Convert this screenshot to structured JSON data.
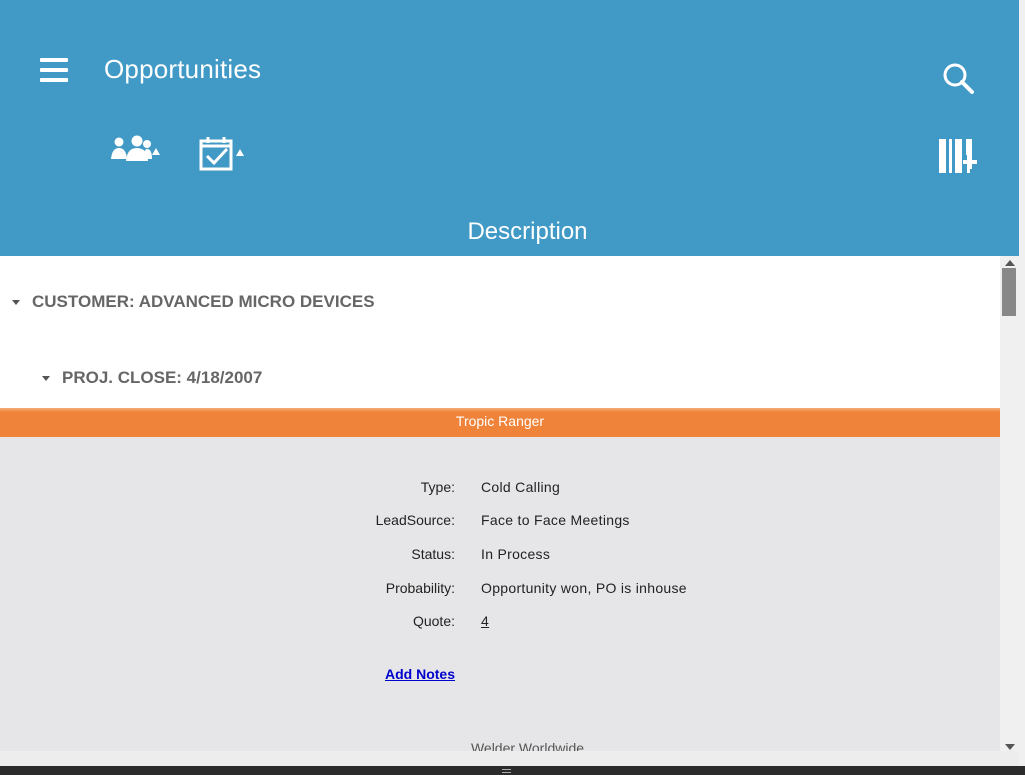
{
  "header": {
    "title": "Opportunities",
    "section_title": "Description",
    "menu_icon": "hamburger-menu-icon",
    "search_icon": "search-icon",
    "group_icon": "group-people-icon",
    "task_icon": "calendar-check-icon",
    "barcode_icon": "barcode-add-icon"
  },
  "groups": {
    "customer": "CUSTOMER: ADVANCED MICRO DEVICES",
    "proj_close": "PROJ. CLOSE: 4/18/2007"
  },
  "record": {
    "title": "Tropic Ranger",
    "fields": [
      {
        "label": "Type:",
        "value": "Cold Calling"
      },
      {
        "label": "LeadSource:",
        "value": "Face to Face Meetings"
      },
      {
        "label": "Status:",
        "value": "In Process"
      },
      {
        "label": "Probability:",
        "value": "Opportunity won, PO is inhouse"
      },
      {
        "label": "Quote:",
        "value": "4"
      }
    ],
    "add_notes": "Add Notes"
  },
  "next_record": {
    "title": "Welder Worldwide"
  },
  "colors": {
    "header_bg": "#4199c6",
    "record_bar": "#ef8339",
    "record_bg": "#e6e6e8",
    "link": "#0000cc"
  }
}
